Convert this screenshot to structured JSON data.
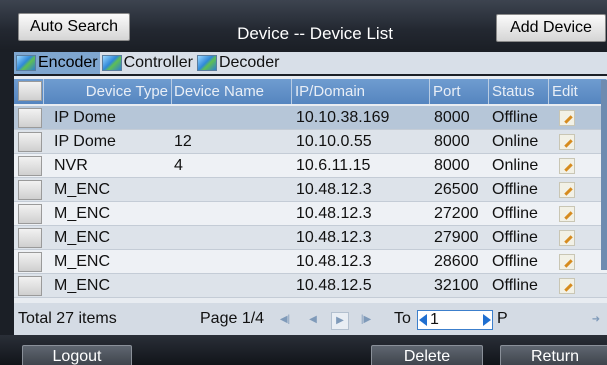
{
  "header": {
    "title": "Device -- Device List",
    "auto_search_label": "Auto Search",
    "add_device_label": "Add Device"
  },
  "tabs": [
    {
      "label": "Encoder",
      "active": true,
      "icon": "device-icon"
    },
    {
      "label": "Controller",
      "active": false,
      "icon": "device-icon"
    },
    {
      "label": "Decoder",
      "active": false,
      "icon": "device-icon"
    }
  ],
  "table": {
    "columns": [
      "Device Type",
      "Device Name",
      "IP/Domain",
      "Port",
      "Status",
      "Edit"
    ],
    "rows": [
      {
        "type": "IP Dome",
        "name": "",
        "ip": "10.10.38.169",
        "port": "8000",
        "status": "Offline"
      },
      {
        "type": "IP Dome",
        "name": "12",
        "ip": "10.10.0.55",
        "port": "8000",
        "status": "Online"
      },
      {
        "type": "NVR",
        "name": "4",
        "ip": "10.6.11.15",
        "port": "8000",
        "status": "Online"
      },
      {
        "type": "M_ENC",
        "name": "",
        "ip": "10.48.12.3",
        "port": "26500",
        "status": "Offline"
      },
      {
        "type": "M_ENC",
        "name": "",
        "ip": "10.48.12.3",
        "port": "27200",
        "status": "Offline"
      },
      {
        "type": "M_ENC",
        "name": "",
        "ip": "10.48.12.3",
        "port": "27900",
        "status": "Offline"
      },
      {
        "type": "M_ENC",
        "name": "",
        "ip": "10.48.12.3",
        "port": "28600",
        "status": "Offline"
      },
      {
        "type": "M_ENC",
        "name": "",
        "ip": "10.48.12.5",
        "port": "32100",
        "status": "Offline"
      }
    ]
  },
  "pager": {
    "total": "Total 27 items",
    "page": "Page 1/4",
    "to_label": "To",
    "page_input": "1",
    "p_label": "P"
  },
  "footer": {
    "logout_label": "Logout",
    "delete_label": "Delete",
    "return_label": "Return"
  },
  "colors": {
    "header_row": "#5585bf",
    "selected_tab": "#7fa6cf",
    "selected_row": "#b6c6d8"
  }
}
